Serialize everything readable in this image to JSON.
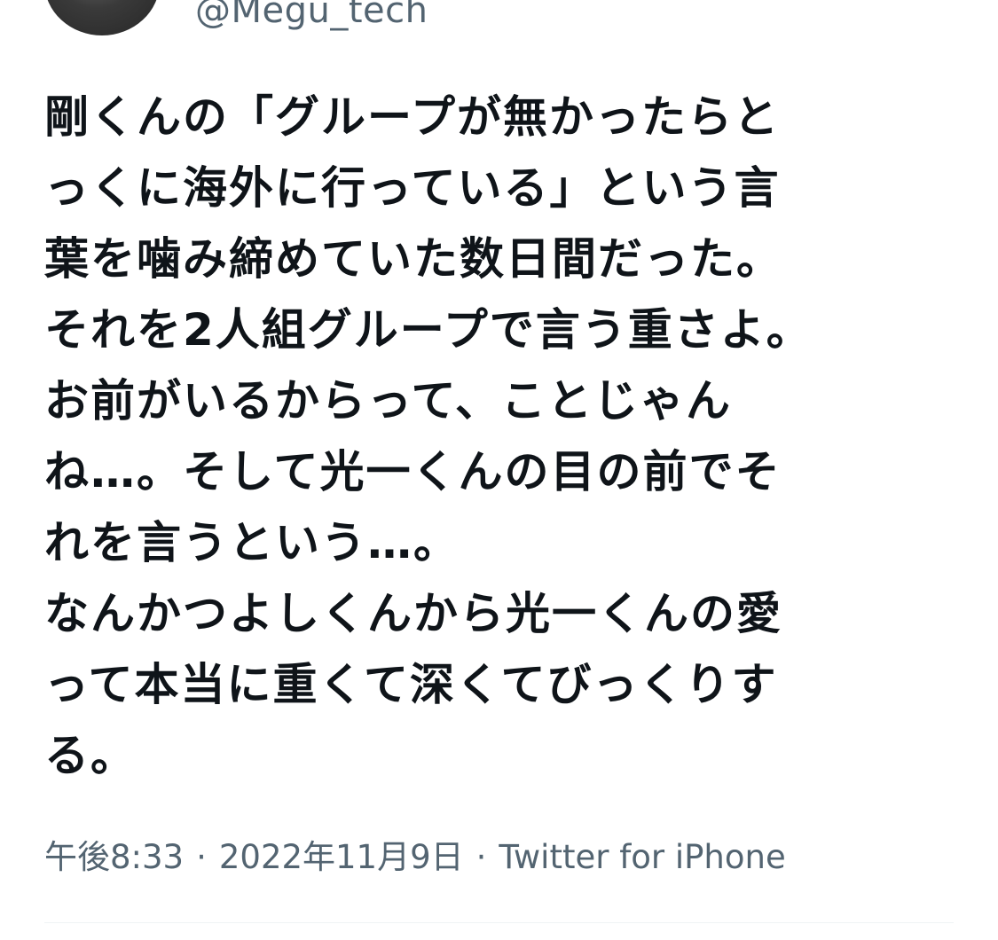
{
  "author": {
    "handle": "@Megu_tech"
  },
  "tweet": {
    "lines": [
      "剛くんの「グループが無かったらと",
      "っくに海外に行っている」という言",
      "葉を噛み締めていた数日間だった。",
      "それを2人組グループで言う重さよ。",
      "お前がいるからって、ことじゃん",
      "ね…。そして光一くんの目の前でそ",
      "れを言うという…。",
      "なんかつよしくんから光一くんの愛",
      "って本当に重くて深くてびっくりす",
      "る。"
    ]
  },
  "meta": {
    "time": "午後8:33",
    "separator": "·",
    "date": "2022年11月9日",
    "client": "Twitter for iPhone"
  }
}
